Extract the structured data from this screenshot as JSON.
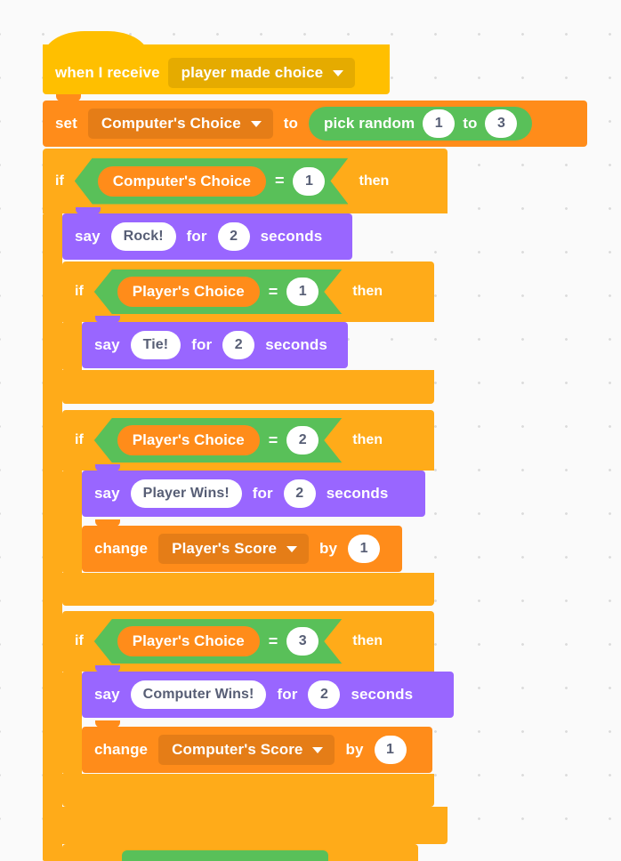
{
  "workspace": {
    "background_color": "#fafafa",
    "grid_dot_color": "#dcdcdc"
  },
  "palette": {
    "events_hat": "#ffbf00",
    "variables": "#ff8c1a",
    "looks": "#9966ff",
    "control": "#ffab19",
    "operators": "#59c059",
    "input_text": "#575e75"
  },
  "script": {
    "hat": {
      "label": "when I receive",
      "message": "player made choice",
      "dropdown_icon": "chevron-down-icon"
    },
    "set_block": {
      "label": "set",
      "variable": "Computer's Choice",
      "to_label": "to",
      "dropdown_icon": "chevron-down-icon",
      "value": {
        "label": "pick random",
        "from": "1",
        "to_label": "to",
        "to": "3"
      }
    },
    "outer_if": {
      "if_label": "if",
      "then_label": "then",
      "condition": {
        "left": "Computer's Choice",
        "operator": "=",
        "right": "1"
      },
      "body": {
        "say_rock": {
          "say_label": "say",
          "message": "Rock!",
          "for_label": "for",
          "seconds": "2",
          "seconds_label": "seconds"
        },
        "if_tie": {
          "if_label": "if",
          "then_label": "then",
          "condition": {
            "left": "Player's Choice",
            "operator": "=",
            "right": "1"
          },
          "say": {
            "say_label": "say",
            "message": "Tie!",
            "for_label": "for",
            "seconds": "2",
            "seconds_label": "seconds"
          }
        },
        "if_player_wins": {
          "if_label": "if",
          "then_label": "then",
          "condition": {
            "left": "Player's Choice",
            "operator": "=",
            "right": "2"
          },
          "say": {
            "say_label": "say",
            "message": "Player Wins!",
            "for_label": "for",
            "seconds": "2",
            "seconds_label": "seconds"
          },
          "change": {
            "change_label": "change",
            "variable": "Player's Score",
            "by_label": "by",
            "amount": "1",
            "dropdown_icon": "chevron-down-icon"
          }
        },
        "if_computer_wins": {
          "if_label": "if",
          "then_label": "then",
          "condition": {
            "left": "Player's Choice",
            "operator": "=",
            "right": "3"
          },
          "say": {
            "say_label": "say",
            "message": "Computer Wins!",
            "for_label": "for",
            "seconds": "2",
            "seconds_label": "seconds"
          },
          "change": {
            "change_label": "change",
            "variable": "Computer's Score",
            "by_label": "by",
            "amount": "1",
            "dropdown_icon": "chevron-down-icon"
          }
        }
      }
    }
  }
}
